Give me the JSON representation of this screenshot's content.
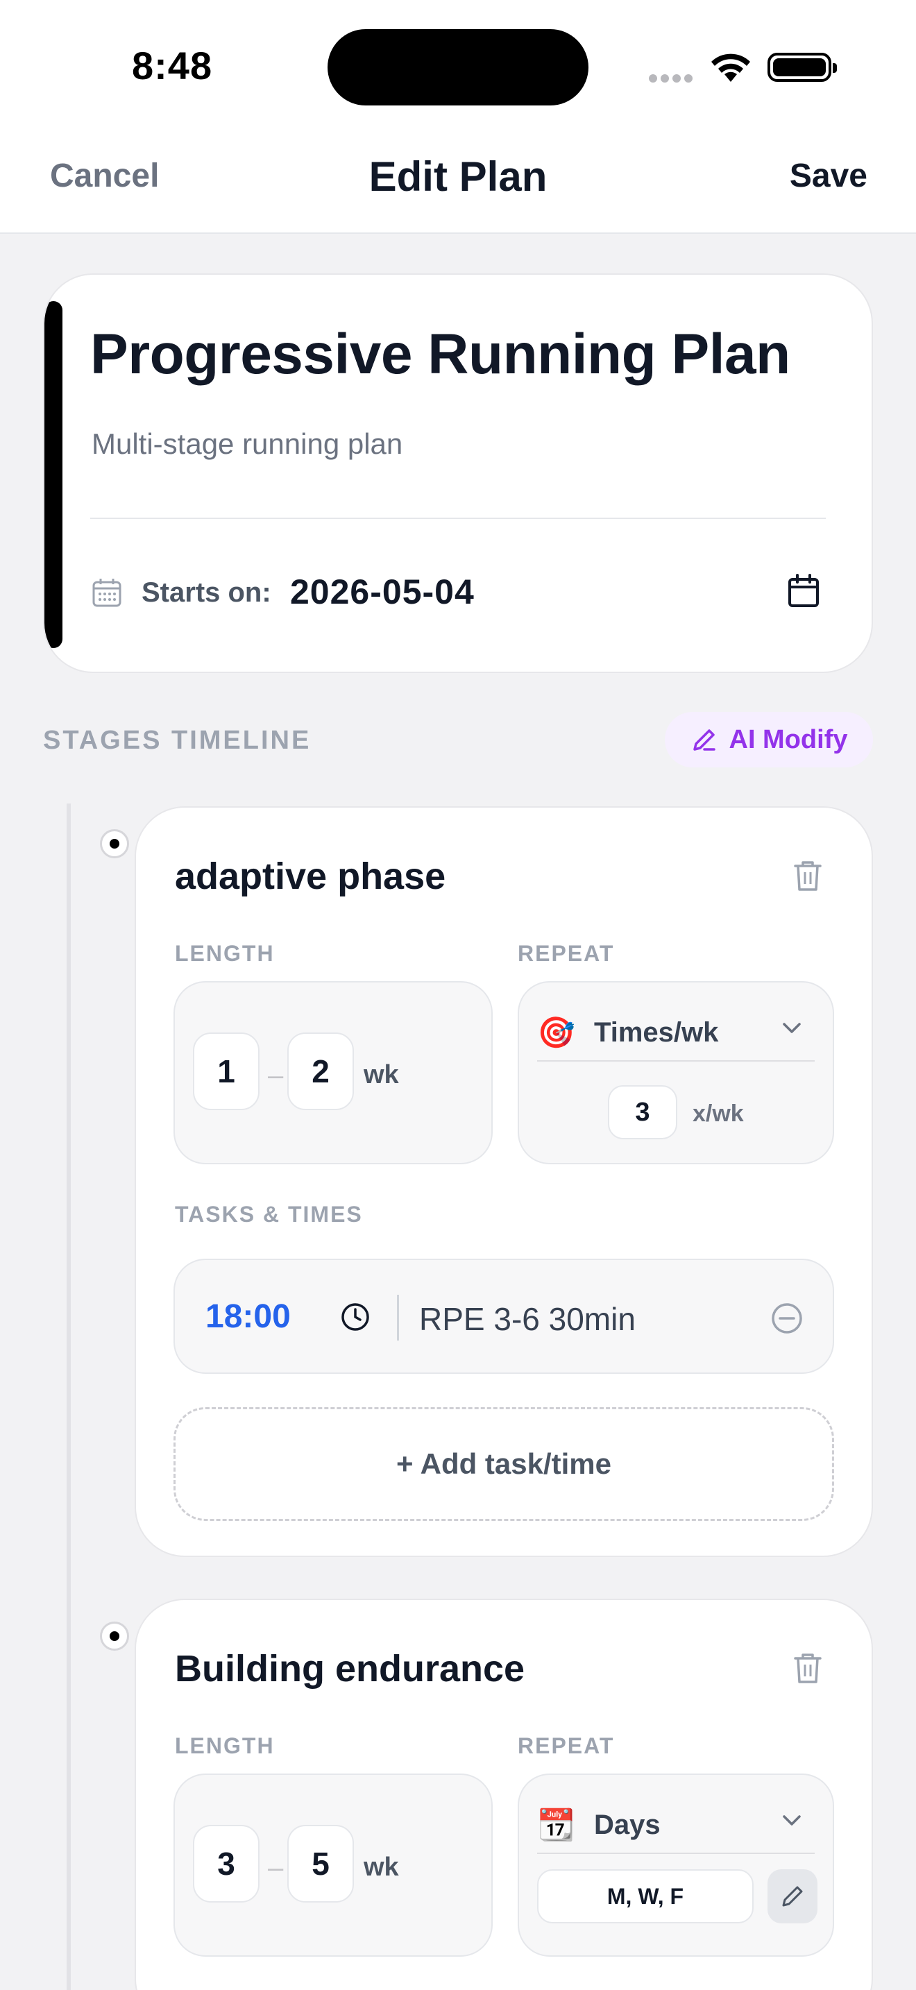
{
  "status_bar": {
    "time": "8:48"
  },
  "nav": {
    "cancel_label": "Cancel",
    "title": "Edit Plan",
    "save_label": "Save"
  },
  "plan": {
    "title": "Progressive Running Plan",
    "description": "Multi-stage running plan",
    "starts_label": "Starts on:",
    "start_date": "2026-05-04",
    "accent_color": "#000000"
  },
  "stages_section": {
    "title": "STAGES TIMELINE",
    "ai_modify_label": "AI Modify",
    "ai_modify_color": "#9333ea"
  },
  "stages": [
    {
      "name": "adaptive phase",
      "length_label": "LENGTH",
      "length_min": "1",
      "length_max": "2",
      "length_unit": "wk",
      "repeat_label": "REPEAT",
      "repeat_icon": "target-emoji",
      "repeat_mode": "Times/wk",
      "repeat_count": "3",
      "repeat_count_unit": "x/wk",
      "tasks_label": "TASKS & TIMES",
      "tasks": [
        {
          "time": "18:00",
          "name": "RPE 3-6 30min"
        }
      ],
      "add_task_label": "+ Add task/time"
    },
    {
      "name": "Building endurance",
      "length_label": "LENGTH",
      "length_min": "3",
      "length_max": "5",
      "length_unit": "wk",
      "repeat_label": "REPEAT",
      "repeat_icon": "calendar-emoji",
      "repeat_mode": "Days",
      "repeat_days": "M, W, F"
    }
  ]
}
